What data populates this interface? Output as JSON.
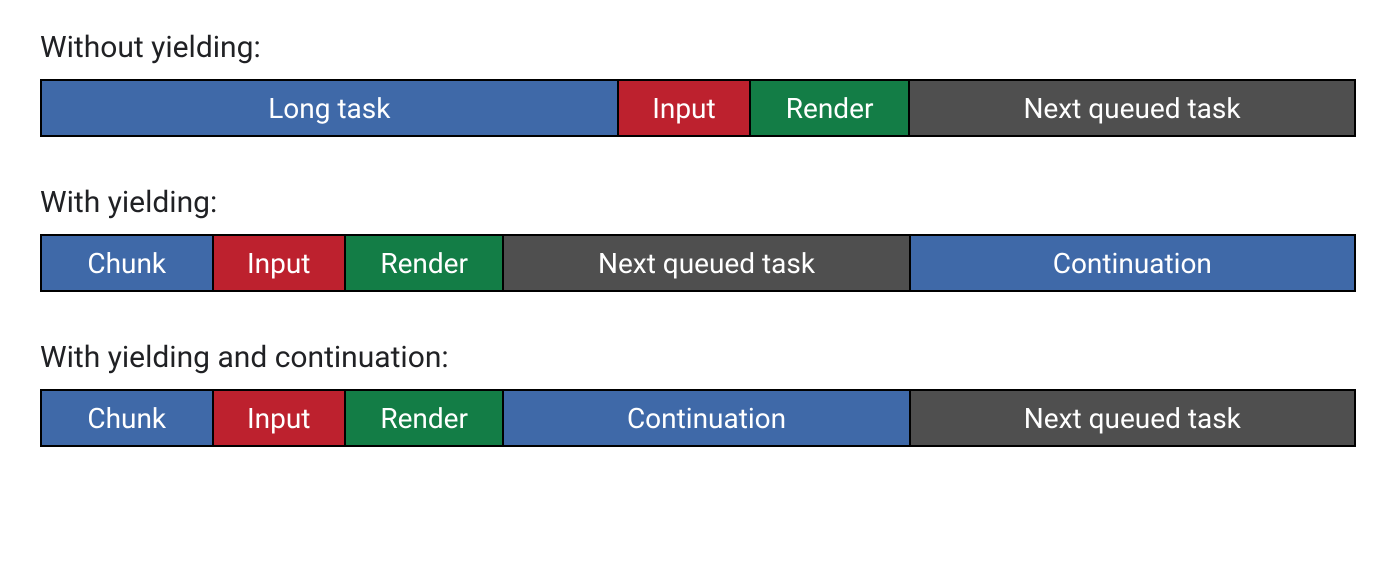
{
  "rows": [
    {
      "title": "Without yielding:",
      "segments": [
        {
          "label": "Long task",
          "color": "blue",
          "flex": 44
        },
        {
          "label": "Input",
          "color": "red",
          "flex": 10
        },
        {
          "label": "Render",
          "color": "green",
          "flex": 12
        },
        {
          "label": "Next queued task",
          "color": "gray",
          "flex": 34
        }
      ]
    },
    {
      "title": "With yielding:",
      "segments": [
        {
          "label": "Chunk",
          "color": "blue",
          "flex": 13
        },
        {
          "label": "Input",
          "color": "red",
          "flex": 10
        },
        {
          "label": "Render",
          "color": "green",
          "flex": 12
        },
        {
          "label": "Next queued task",
          "color": "gray",
          "flex": 31
        },
        {
          "label": "Continuation",
          "color": "blue",
          "flex": 34
        }
      ]
    },
    {
      "title": "With yielding and continuation:",
      "segments": [
        {
          "label": "Chunk",
          "color": "blue",
          "flex": 13
        },
        {
          "label": "Input",
          "color": "red",
          "flex": 10
        },
        {
          "label": "Render",
          "color": "green",
          "flex": 12
        },
        {
          "label": "Continuation",
          "color": "blue",
          "flex": 31
        },
        {
          "label": "Next queued task",
          "color": "gray",
          "flex": 34
        }
      ]
    }
  ]
}
